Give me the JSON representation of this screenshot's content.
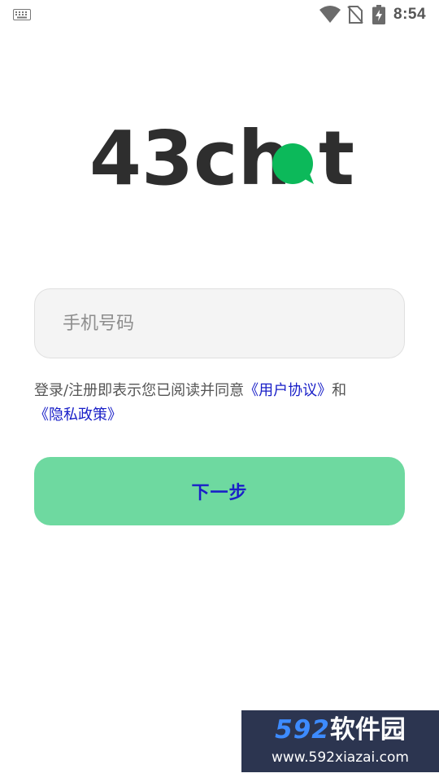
{
  "status_bar": {
    "time": "8:54",
    "icons": [
      "keyboard-icon",
      "wifi-icon",
      "no-sim-icon",
      "battery-charging-icon"
    ]
  },
  "logo": {
    "text_prefix": "43ch",
    "text_suffix": "t",
    "bubble_color": "#0cb95a",
    "text_color": "#2e2e2e"
  },
  "login": {
    "phone_placeholder": "手机号码",
    "phone_value": "",
    "agreement_prefix": "登录/注册即表示您已阅读并同意",
    "user_agreement_link": "《用户协议》",
    "agreement_and": "和",
    "privacy_policy_link": "《隐私政策》",
    "next_button_label": "下一步"
  },
  "colors": {
    "button_bg": "#6ed9a0",
    "link": "#1a20c8",
    "input_bg": "#f4f4f4"
  },
  "watermark": {
    "number": "592",
    "name": "软件园",
    "url": "www.592xiazai.com"
  }
}
